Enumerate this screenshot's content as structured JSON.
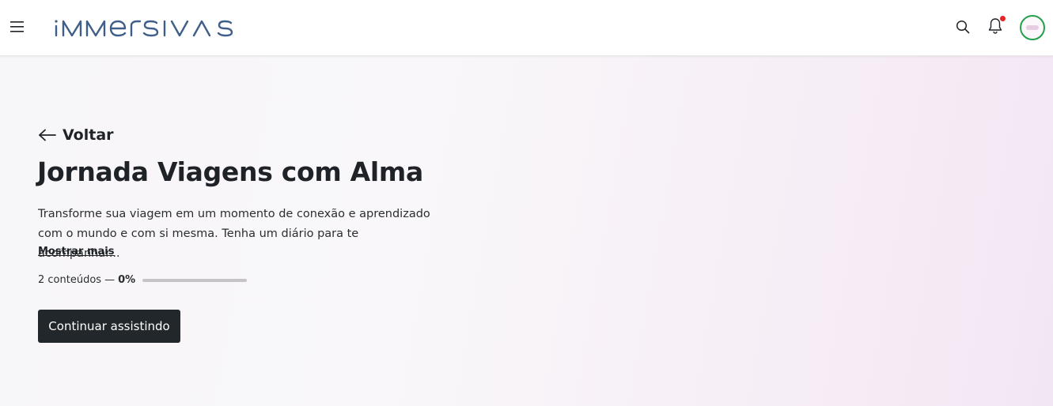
{
  "header": {
    "logo_text": "IMMERSIVAS",
    "logo_color": "#3f5f8a",
    "menu_icon": "hamburger-menu-icon",
    "search_icon": "search-icon",
    "notification_icon": "bell-icon",
    "notification_dot_color": "#e0262b",
    "avatar_border_color": "#22a04a"
  },
  "hero": {
    "back_label": "Voltar",
    "back_icon": "arrow-left-icon",
    "title": "Jornada Viagens com Alma",
    "description": "Transforme sua viagem em um momento de conexão e aprendizado com o mundo e com si mesma. Tenha um diário para te acompanhar...",
    "show_more_label": "Mostrar mais",
    "contents_count": "2 conteúdos",
    "separator": "—",
    "progress_label": "0%",
    "progress_fraction": 0,
    "cta_label": "Continuar assistindo"
  }
}
